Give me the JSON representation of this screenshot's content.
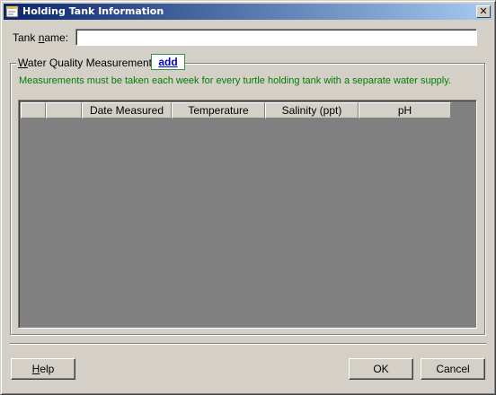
{
  "window": {
    "title": "Holding Tank Information",
    "close_label": "✕"
  },
  "tank_name": {
    "label_pre": "Tank ",
    "label_mnemonic": "n",
    "label_post": "ame:",
    "value": ""
  },
  "water_quality": {
    "group_label_mnemonic": "W",
    "group_label_rest": "ater Quality Measurements",
    "add_link": "add",
    "notice": "Measurements must be taken each week for every turtle holding tank with a separate water supply.",
    "columns": [
      "",
      "",
      "Date Measured",
      "Temperature",
      "Salinity (ppt)",
      "pH"
    ],
    "rows": []
  },
  "buttons": {
    "help_mnemonic": "H",
    "help_rest": "elp",
    "ok": "OK",
    "cancel": "Cancel"
  },
  "icons": {
    "title_icon": "form-window-icon"
  }
}
